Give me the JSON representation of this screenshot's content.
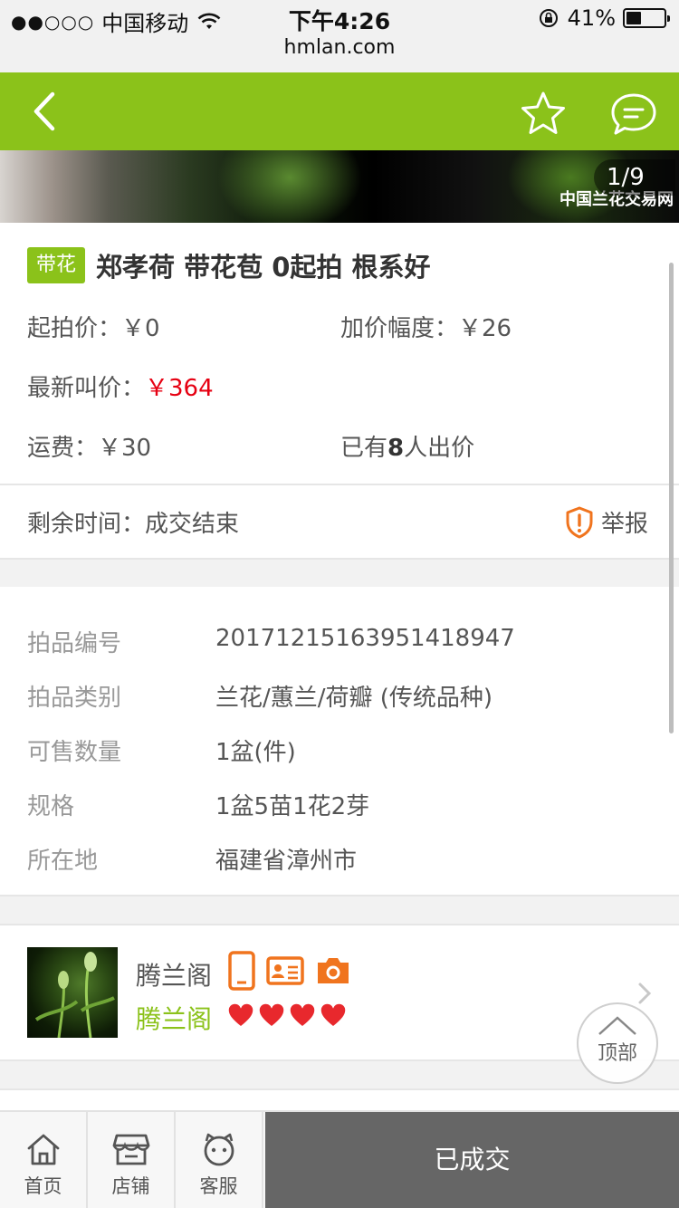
{
  "status_bar": {
    "signal": "●●○○○",
    "carrier": "中国移动",
    "time": "下午4:26",
    "battery_percent": "41%",
    "battery_level": 0.41,
    "url": "hmlan.com"
  },
  "header": {
    "back_icon": "chevron-left-icon",
    "favorite_icon": "star-icon",
    "message_icon": "chat-bubble-icon",
    "background": "#8bc21a"
  },
  "banner": {
    "counter": "1/9",
    "watermark": "中国兰花交易网"
  },
  "item": {
    "tag": "带花",
    "title": "郑孝荷 带花苞 0起拍 根系好",
    "start_price_label": "起拍价：",
    "start_price": "￥0",
    "increment_label": "加价幅度：",
    "increment": "￥26",
    "latest_bid_label": "最新叫价：",
    "latest_bid": "￥364",
    "shipping_label": "运费：",
    "shipping": "￥30",
    "bidders_prefix": "已有",
    "bidders_count": "8",
    "bidders_suffix": "人出价",
    "remaining_label": "剩余时间：",
    "remaining_value": "成交结束",
    "report_label": "举报"
  },
  "specs": [
    {
      "label": "拍品编号",
      "value": "20171215163951418947"
    },
    {
      "label": "拍品类别",
      "value": "兰花/蕙兰/荷瓣 (传统品种)"
    },
    {
      "label": "可售数量",
      "value": "1盆(件)"
    },
    {
      "label": "规格",
      "value": "1盆5苗1花2芽"
    },
    {
      "label": "所在地",
      "value": "福建省漳州市"
    }
  ],
  "seller": {
    "name": "腾兰阁",
    "shop": "腾兰阁",
    "badges": [
      "phone-icon",
      "id-card-icon",
      "camera-icon"
    ],
    "hearts": 4
  },
  "back_to_top": "顶部",
  "bottom_bar": {
    "tabs": [
      {
        "label": "首页",
        "icon": "home-icon"
      },
      {
        "label": "店铺",
        "icon": "store-icon"
      },
      {
        "label": "客服",
        "icon": "service-face-icon"
      }
    ],
    "deal_label": "已成交"
  },
  "colors": {
    "accent_green": "#8bc21a",
    "price_red": "#e60012",
    "badge_orange": "#f0741e"
  }
}
